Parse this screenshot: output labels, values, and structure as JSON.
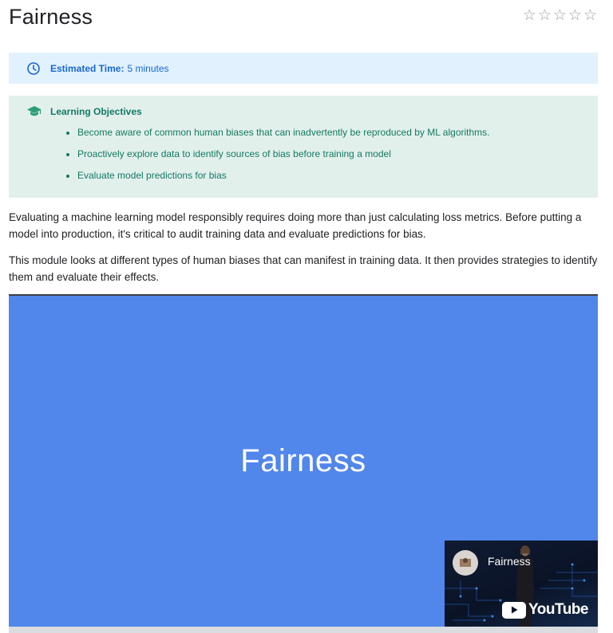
{
  "page": {
    "title": "Fairness"
  },
  "rating": {
    "stars": [
      "☆",
      "☆",
      "☆",
      "☆",
      "☆"
    ],
    "value": 0,
    "max": 5
  },
  "estimated_time": {
    "label": "Estimated Time:",
    "value": "5 minutes",
    "icon": "clock-icon",
    "color": "#1967d2"
  },
  "learning_objectives": {
    "heading": "Learning Objectives",
    "icon": "graduation-cap-icon",
    "color": "#137a5f",
    "items": [
      "Become aware of common human biases that can inadvertently be reproduced by ML algorithms.",
      "Proactively explore data to identify sources of bias before training a model",
      "Evaluate model predictions for bias"
    ]
  },
  "body": {
    "paragraph1": "Evaluating a machine learning model responsibly requires doing more than just calculating loss metrics. Before putting a model into production, it's critical to audit training data and evaluate predictions for bias.",
    "paragraph2": "This module looks at different types of human biases that can manifest in training data. It then provides strategies to identify them and evaluate their effects."
  },
  "video": {
    "title": "Fairness",
    "background": "#5186eb",
    "thumbnail": {
      "title": "Fairness",
      "brand": "YouTube"
    }
  }
}
